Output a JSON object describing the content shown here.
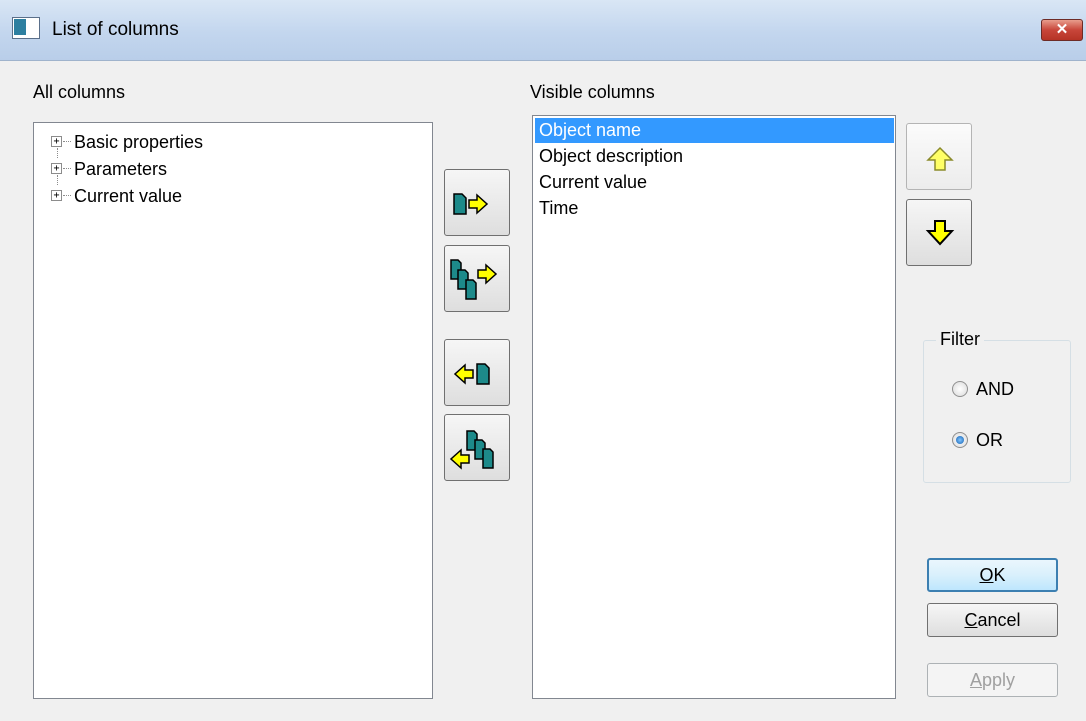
{
  "window": {
    "title": "List of columns",
    "close_label": "✕"
  },
  "all_columns": {
    "label": "All columns",
    "items": [
      {
        "label": "Basic properties"
      },
      {
        "label": "Parameters"
      },
      {
        "label": "Current value"
      }
    ]
  },
  "visible_columns": {
    "label": "Visible columns",
    "items": [
      "Object name",
      "Object description",
      "Current value",
      "Time"
    ],
    "selected_index": 0
  },
  "transfer_buttons": [
    {
      "name": "add-selected",
      "icon": "page-arrow-right-icon"
    },
    {
      "name": "add-all",
      "icon": "pages-arrow-right-icon"
    },
    {
      "name": "remove-selected",
      "icon": "arrow-left-page-icon"
    },
    {
      "name": "remove-all",
      "icon": "arrow-left-pages-icon"
    }
  ],
  "order_buttons": [
    {
      "name": "move-up",
      "icon": "arrow-up-icon"
    },
    {
      "name": "move-down",
      "icon": "arrow-down-icon"
    }
  ],
  "filter": {
    "label": "Filter",
    "options": [
      {
        "label": "AND",
        "checked": false
      },
      {
        "label": "OR",
        "checked": true
      }
    ]
  },
  "buttons": {
    "ok": {
      "mnemonic": "O",
      "rest": "K"
    },
    "cancel": {
      "mnemonic": "C",
      "rest": "ancel"
    },
    "apply": {
      "mnemonic": "A",
      "rest": "pply",
      "disabled": true
    }
  },
  "colors": {
    "accent_selection": "#3399ff",
    "arrow_yellow": "#ffff00",
    "page_teal": "#1d8a8a"
  }
}
